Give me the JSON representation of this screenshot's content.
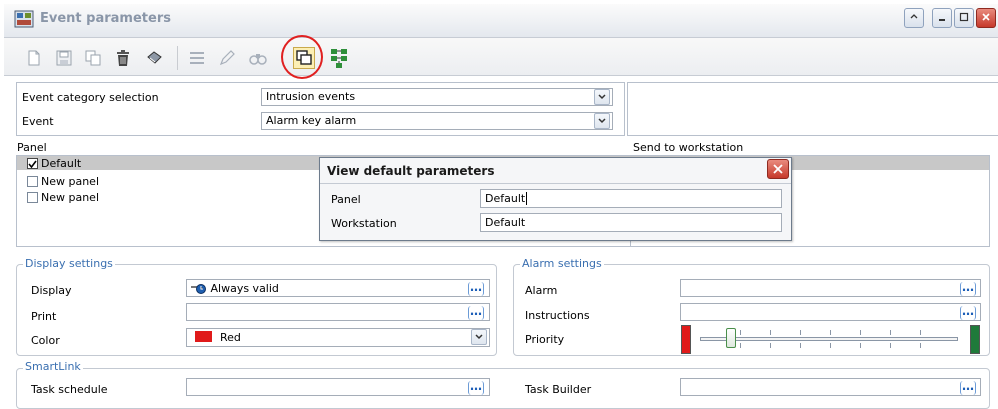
{
  "window": {
    "title": "Event parameters"
  },
  "toolbar": {
    "buttons": [
      "new-icon",
      "save-icon",
      "copy-icon",
      "delete-icon",
      "print-icon",
      "list-icon",
      "edit-icon",
      "find-icon",
      "view-default-parameters-icon",
      "network-icon"
    ]
  },
  "top": {
    "category_label": "Event category selection",
    "category_value": "Intrusion events",
    "event_label": "Event",
    "event_value": "Alarm key alarm"
  },
  "panel_section": {
    "panel_header": "Panel",
    "workstation_header": "Send to workstation",
    "items": [
      {
        "label": "Default",
        "checked": true
      },
      {
        "label": "New panel",
        "checked": false
      },
      {
        "label": "New panel",
        "checked": false
      }
    ]
  },
  "dialog": {
    "title": "View default parameters",
    "panel_label": "Panel",
    "panel_value": "Default",
    "workstation_label": "Workstation",
    "workstation_value": "Default"
  },
  "display_settings": {
    "legend": "Display settings",
    "display_label": "Display",
    "display_value": "Always valid",
    "print_label": "Print",
    "print_value": "",
    "color_label": "Color",
    "color_value": "Red",
    "color_swatch": "#e01a1a"
  },
  "alarm_settings": {
    "legend": "Alarm settings",
    "alarm_label": "Alarm",
    "alarm_value": "",
    "instructions_label": "Instructions",
    "instructions_value": "",
    "priority_label": "Priority",
    "priority_low_color": "#e01a1a",
    "priority_high_color": "#1f7a3a",
    "priority_level_fraction": 0.1
  },
  "smartlink": {
    "legend": "SmartLink",
    "task_schedule_label": "Task schedule",
    "task_schedule_value": "",
    "task_builder_label": "Task Builder",
    "task_builder_value": ""
  },
  "ellipsis": "…",
  "colors": {
    "accent": "#3a6fb0",
    "highlight_ring": "#e02020"
  }
}
